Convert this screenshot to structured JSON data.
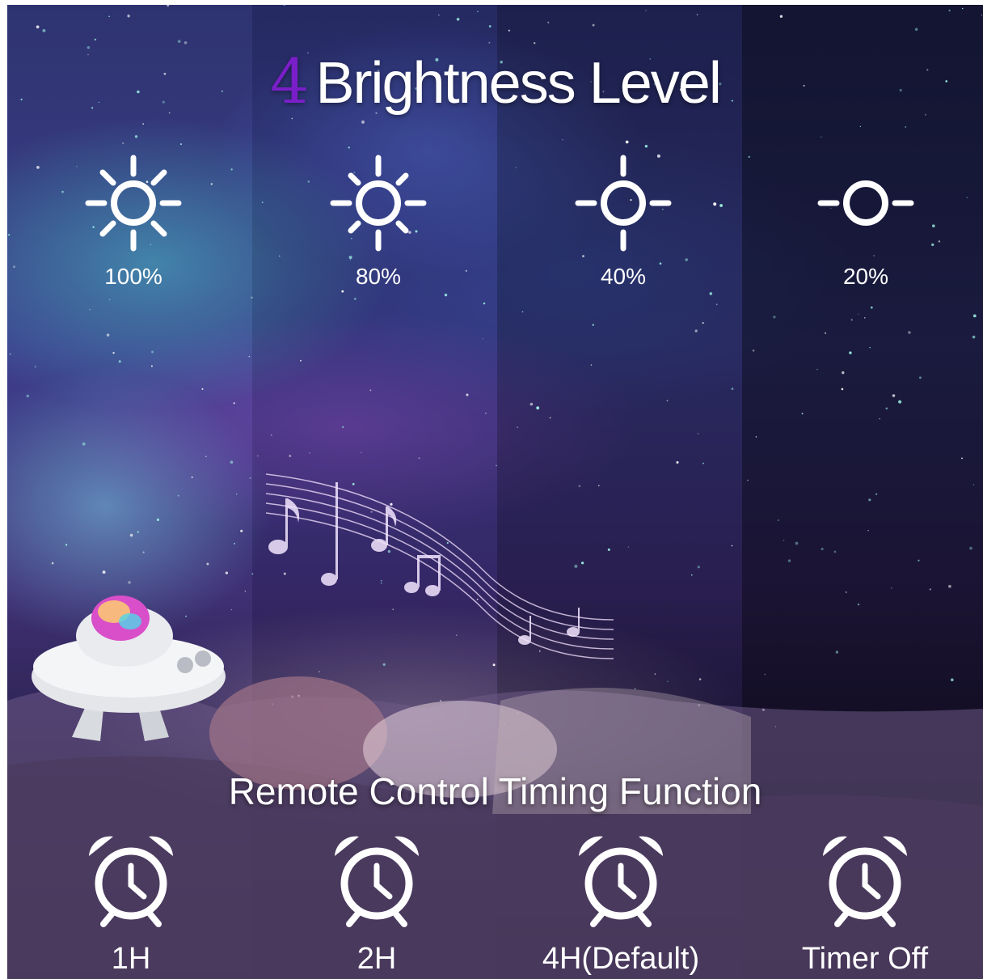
{
  "heading": {
    "number": "4",
    "text": "Brightness Level",
    "number_color": "#7a1ec9"
  },
  "brightness_levels": [
    {
      "label": "100%",
      "icon": "sun-full-icon"
    },
    {
      "label": "80%",
      "icon": "sun-medium-icon"
    },
    {
      "label": "40%",
      "icon": "sun-low-icon"
    },
    {
      "label": "20%",
      "icon": "sun-dim-icon"
    }
  ],
  "subheading": "Remote Control Timing Function",
  "timers": [
    {
      "label": "1H",
      "icon": "alarm-clock-icon"
    },
    {
      "label": "2H",
      "icon": "alarm-clock-icon"
    },
    {
      "label": "4H(Default)",
      "icon": "alarm-clock-icon"
    },
    {
      "label": "Timer Off",
      "icon": "alarm-clock-icon"
    }
  ]
}
